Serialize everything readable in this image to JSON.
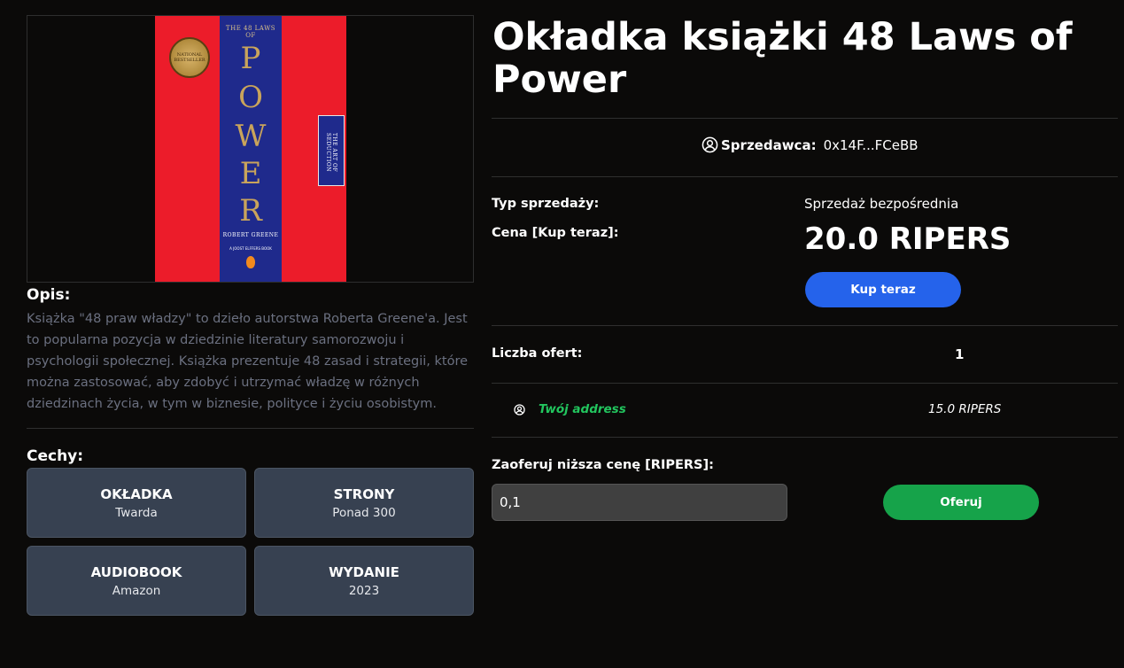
{
  "product": {
    "title": "Okładka książki 48 Laws of Power",
    "image": {
      "series_text": "THE 48 LAWS OF",
      "title_letters": [
        "P",
        "O",
        "W",
        "E",
        "R"
      ],
      "author": "ROBERT GREENE",
      "tagline": "A JOOST ELFFERS BOOK",
      "seal_text": "NATIONAL BESTSELLER",
      "side_book_text": "THE ART OF SEDUCTION"
    }
  },
  "description": {
    "heading": "Opis:",
    "text": "Książka \"48 praw władzy\" to dzieło autorstwa Roberta Greene'a. Jest to popularna pozycja w dziedzinie literatury samorozwoju i psychologii społecznej. Książka prezentuje 48 zasad i strategii, które można zastosować, aby zdobyć i utrzymać władzę w różnych dziedzinach życia, w tym w biznesie, polityce i życiu osobistym."
  },
  "features": {
    "heading": "Cechy:",
    "items": [
      {
        "name": "OKŁADKA",
        "value": "Twarda"
      },
      {
        "name": "STRONY",
        "value": "Ponad 300"
      },
      {
        "name": "AUDIOBOOK",
        "value": "Amazon"
      },
      {
        "name": "WYDANIE",
        "value": "2023"
      }
    ]
  },
  "seller": {
    "label": "Sprzedawca:",
    "address": "0x14F...FCeBB",
    "icon": "user-circle-icon"
  },
  "sale": {
    "type_label": "Typ sprzedaży:",
    "type_value": "Sprzedaż bezpośrednia",
    "price_label": "Cena [Kup teraz]:",
    "price_value": "20.0 RIPERS",
    "buy_label": "Kup teraz"
  },
  "offers": {
    "count_label": "Liczba ofert:",
    "count_value": "1",
    "items": [
      {
        "address": "Twój address",
        "amount": "15.0 RIPERS",
        "icon": "user-circle-icon"
      }
    ]
  },
  "make_offer": {
    "label": "Zaoferuj niższa cenę [RIPERS]:",
    "input_value": "0,1",
    "button_label": "Oferuj"
  },
  "colors": {
    "background": "#0b0a09",
    "buy_button": "#2563eb",
    "offer_button": "#16a34a",
    "offer_address": "#22c55e",
    "feature_card": "#374151"
  }
}
